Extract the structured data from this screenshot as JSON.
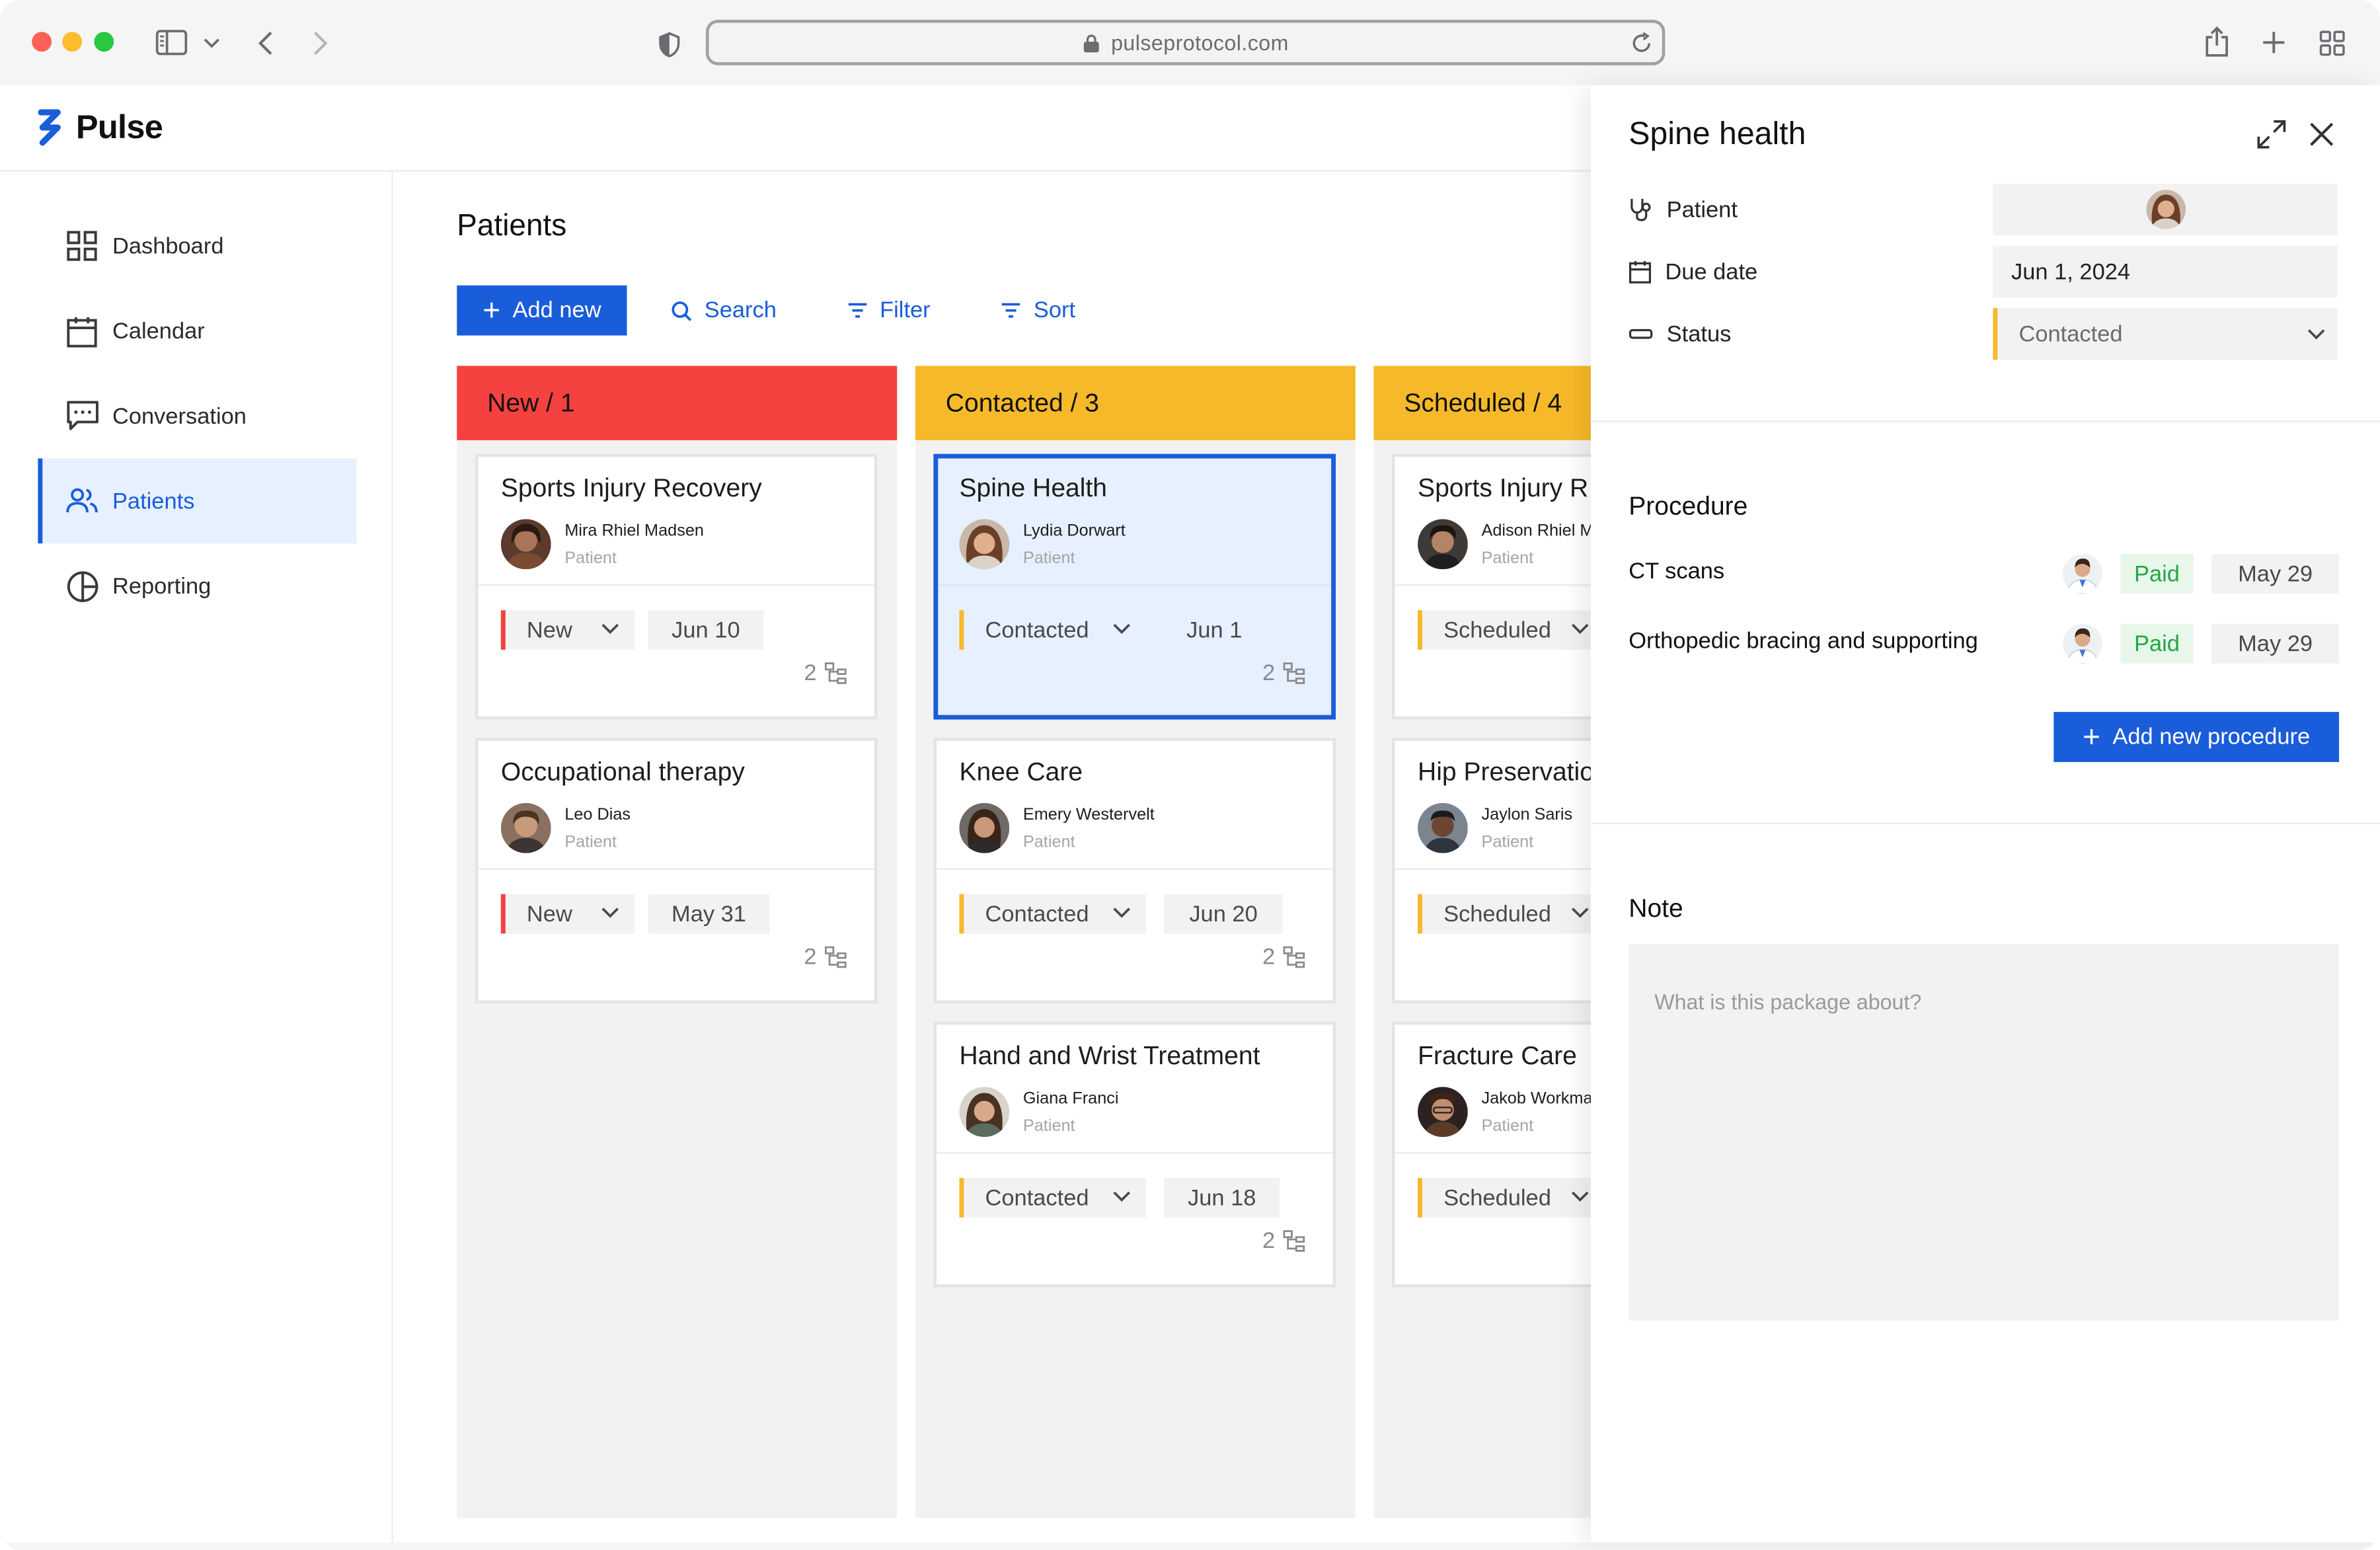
{
  "browser": {
    "url": "pulseprotocol.com"
  },
  "app": {
    "name": "Pulse",
    "brand_color": "#1a5ddb"
  },
  "sidebar": {
    "items": [
      {
        "label": "Dashboard",
        "icon": "grid-icon",
        "active": false
      },
      {
        "label": "Calendar",
        "icon": "calendar-icon",
        "active": false
      },
      {
        "label": "Conversation",
        "icon": "chat-icon",
        "active": false
      },
      {
        "label": "Patients",
        "icon": "users-icon",
        "active": true
      },
      {
        "label": "Reporting",
        "icon": "pie-chart-icon",
        "active": false
      }
    ]
  },
  "main": {
    "title": "Patients",
    "toolbar": {
      "add_label": "Add new",
      "search_label": "Search",
      "filter_label": "Filter",
      "sort_label": "Sort"
    },
    "columns": [
      {
        "title": "New / 1",
        "color": "#f5413f",
        "cards": [
          {
            "title": "Sports Injury Recovery",
            "patient": "Mira Rhiel Madsen",
            "role": "Patient",
            "status": "New",
            "date": "Jun 10",
            "count": "2"
          },
          {
            "title": "Occupational therapy",
            "patient": "Leo Dias",
            "role": "Patient",
            "status": "New",
            "date": "May 31",
            "count": "2"
          }
        ]
      },
      {
        "title": "Contacted / 3",
        "color": "#f6b929",
        "cards": [
          {
            "title": "Spine Health",
            "patient": "Lydia Dorwart",
            "role": "Patient",
            "status": "Contacted",
            "date": "Jun 1",
            "count": "2",
            "selected": true
          },
          {
            "title": "Knee Care",
            "patient": "Emery Westervelt",
            "role": "Patient",
            "status": "Contacted",
            "date": "Jun 20",
            "count": "2"
          },
          {
            "title": "Hand and Wrist Treatment",
            "patient": "Giana Franci",
            "role": "Patient",
            "status": "Contacted",
            "date": "Jun 18",
            "count": "2"
          }
        ]
      },
      {
        "title": "Scheduled / 4",
        "color": "#f6b929",
        "cards": [
          {
            "title": "Sports Injury R",
            "patient": "Adison Rhiel Ma",
            "role": "Patient",
            "status": "Scheduled"
          },
          {
            "title": "Hip Preservatio",
            "patient": "Jaylon Saris",
            "role": "Patient",
            "status": "Scheduled"
          },
          {
            "title": "Fracture Care",
            "patient": "Jakob Workman",
            "role": "Patient",
            "status": "Scheduled"
          }
        ]
      }
    ]
  },
  "panel": {
    "title": "Spine health",
    "props": {
      "patient_label": "Patient",
      "due_label": "Due date",
      "due_value": "Jun 1, 2024",
      "status_label": "Status",
      "status_value": "Contacted"
    },
    "procedure": {
      "title": "Procedure",
      "items": [
        {
          "name": "CT scans",
          "payment": "Paid",
          "date": "May 29"
        },
        {
          "name": "Orthopedic bracing and supporting",
          "payment": "Paid",
          "date": "May 29"
        }
      ],
      "add_label": "Add new procedure"
    },
    "note": {
      "title": "Note",
      "placeholder": "What is this package about?"
    }
  }
}
